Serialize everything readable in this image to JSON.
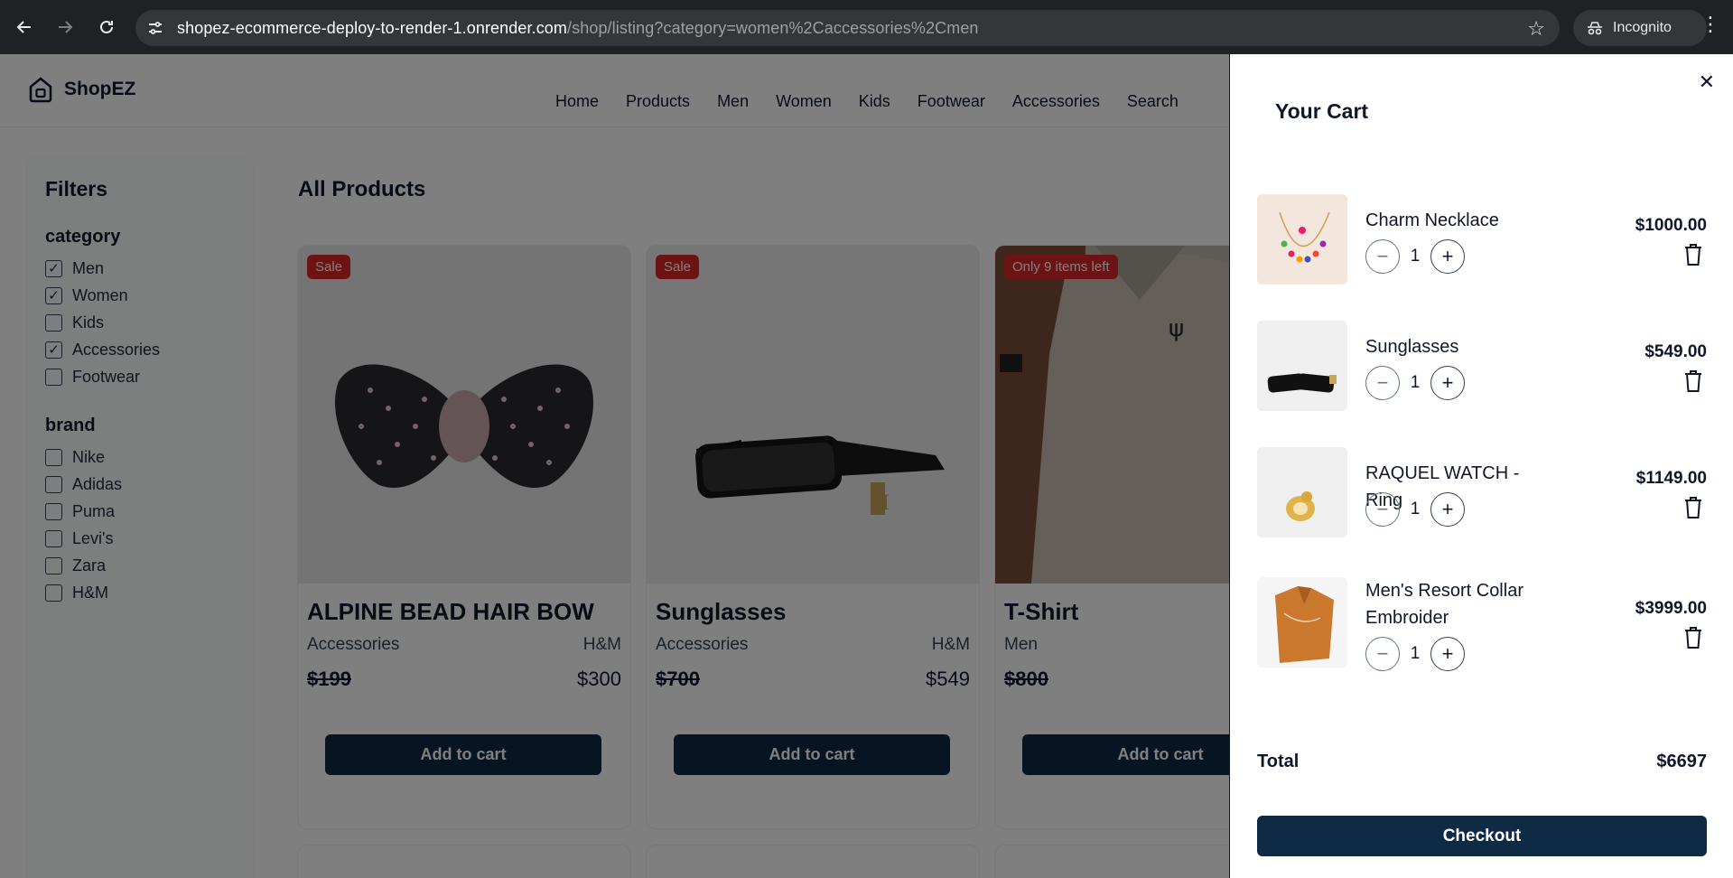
{
  "browser": {
    "url_host": "shopez-ecommerce-deploy-to-render-1.onrender.com",
    "url_path": "/shop/listing?category=women%2Caccessories%2Cmen",
    "incognito_label": "Incognito"
  },
  "header": {
    "brand": "ShopEZ",
    "nav": [
      "Home",
      "Products",
      "Men",
      "Women",
      "Kids",
      "Footwear",
      "Accessories",
      "Search"
    ]
  },
  "filters": {
    "title": "Filters",
    "category": {
      "label": "category",
      "options": [
        {
          "label": "Men",
          "checked": true
        },
        {
          "label": "Women",
          "checked": true
        },
        {
          "label": "Kids",
          "checked": false
        },
        {
          "label": "Accessories",
          "checked": true
        },
        {
          "label": "Footwear",
          "checked": false
        }
      ]
    },
    "brand": {
      "label": "brand",
      "options": [
        {
          "label": "Nike",
          "checked": false
        },
        {
          "label": "Adidas",
          "checked": false
        },
        {
          "label": "Puma",
          "checked": false
        },
        {
          "label": "Levi's",
          "checked": false
        },
        {
          "label": "Zara",
          "checked": false
        },
        {
          "label": "H&M",
          "checked": false
        }
      ]
    }
  },
  "listing": {
    "title": "All Products",
    "products": [
      {
        "badge": "Sale",
        "name": "ALPINE BEAD HAIR BOW",
        "category": "Accessories",
        "brand": "H&M",
        "old_price": "$199",
        "price": "$300",
        "button": "Add to cart"
      },
      {
        "badge": "Sale",
        "name": "Sunglasses",
        "category": "Accessories",
        "brand": "H&M",
        "old_price": "$700",
        "price": "$549",
        "button": "Add to cart"
      },
      {
        "badge": "Only 9 items left",
        "name": "T-Shirt",
        "category": "Men",
        "brand": "",
        "old_price": "$800",
        "price": "",
        "button": "Add to cart"
      }
    ]
  },
  "cart": {
    "title": "Your Cart",
    "items": [
      {
        "name": "Charm Necklace",
        "qty": "1",
        "price": "$1000.00"
      },
      {
        "name": "Sunglasses",
        "qty": "1",
        "price": "$549.00"
      },
      {
        "name": "RAQUEL WATCH - Ring",
        "qty": "1",
        "price": "$1149.00"
      },
      {
        "name": "Men's Resort Collar Embroider",
        "qty": "1",
        "price": "$3999.00"
      }
    ],
    "total_label": "Total",
    "total_value": "$6697",
    "checkout_label": "Checkout"
  },
  "colors": {
    "primary": "#0f2a44",
    "badge": "#dc2626",
    "chrome": "#202124"
  }
}
